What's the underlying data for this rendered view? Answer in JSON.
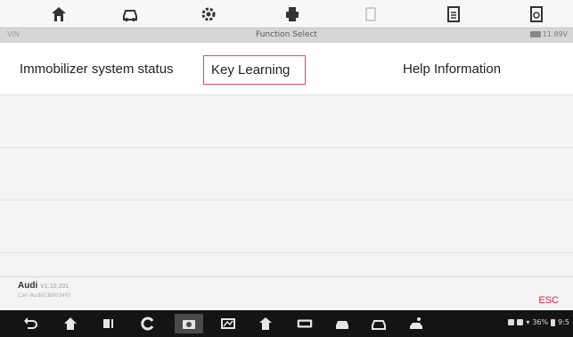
{
  "toolbar": {
    "icons": [
      "home-icon",
      "vehicle-icon",
      "settings-icon",
      "print-icon",
      "help-icon",
      "save-icon",
      "data-logging-icon"
    ]
  },
  "header": {
    "vin": "VIN",
    "title": "Function Select",
    "battery": "11.89V"
  },
  "functions": {
    "row1": {
      "col1": "Immobilizer system status",
      "col2": "Key Learning",
      "col3": "Help Information"
    }
  },
  "footer": {
    "brand": "Audi",
    "version": "V1.10.201",
    "sub": "Can Audi(CB00349)",
    "esc": "ESC"
  },
  "statusbar": {
    "battery_pct": "36%",
    "time": "9:5"
  },
  "colors": {
    "accent": "#e04a68",
    "esc": "#e2233d"
  }
}
